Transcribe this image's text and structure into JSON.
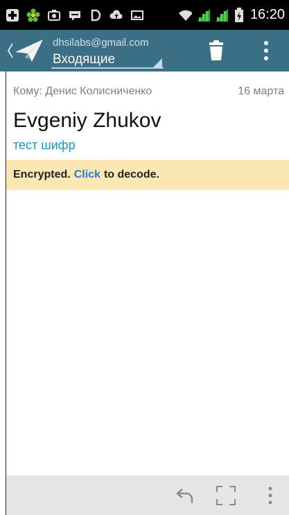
{
  "status_bar": {
    "time": "16:20",
    "icons": [
      "plus-icon",
      "flower-icon",
      "camera-icon",
      "chat-icon",
      "d-icon",
      "cloud-upload-icon",
      "image-icon",
      "wifi-icon",
      "signal-icon",
      "signal-icon",
      "battery-icon"
    ]
  },
  "action_bar": {
    "account": "dhsilabs@gmail.com",
    "folder": "Входящие",
    "colors": {
      "bar": "#3a6f86",
      "account_text": "#cfe0e7"
    }
  },
  "message": {
    "to_line": "Кому: Денис Колисниченко",
    "date": "16 марта",
    "sender": "Evgeniy Zhukov",
    "subject": "тест шифр"
  },
  "banner": {
    "prefix": "Encrypted.",
    "link": "Click",
    "suffix": "to decode.",
    "colors": {
      "background": "#fbe7b3",
      "link": "#2a7bd8"
    }
  },
  "bottom_bar": {
    "icons": [
      "reply-icon",
      "fullscreen-icon",
      "more-vertical-icon"
    ]
  }
}
